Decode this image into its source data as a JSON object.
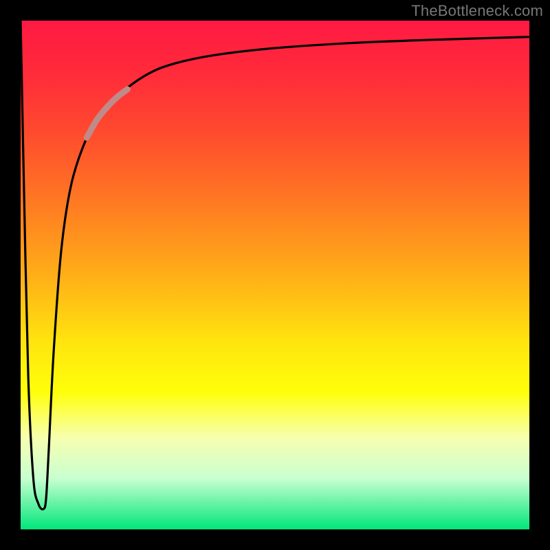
{
  "attribution": "TheBottleneck.com",
  "colors": {
    "background": "#000000",
    "gradient_top": "#ff1a44",
    "gradient_bottom": "#00e67a",
    "curve": "#000000",
    "highlight_segment": "#c08a88"
  },
  "chart_data": {
    "type": "line",
    "title": "",
    "xlabel": "",
    "ylabel": "",
    "xlim": [
      0,
      100
    ],
    "ylim": [
      0,
      100
    ],
    "axis_labels_visible": false,
    "gradient_stops": [
      {
        "pos": 0,
        "color": "#ff1a44"
      },
      {
        "pos": 36,
        "color": "#ff7a22"
      },
      {
        "pos": 63,
        "color": "#ffe40e"
      },
      {
        "pos": 82,
        "color": "#f7ffb0"
      },
      {
        "pos": 100,
        "color": "#00e67a"
      }
    ],
    "series": [
      {
        "name": "curve-main",
        "x": [
          0.0,
          0.7,
          1.5,
          2.5,
          3.5,
          4.5,
          5.0,
          5.5,
          6.5,
          8.0,
          10.0,
          13.0,
          16.0,
          20.0,
          25.0,
          30.0,
          38.0,
          50.0,
          65.0,
          80.0,
          100.0
        ],
        "y": [
          100.0,
          65.0,
          30.0,
          10.0,
          5.0,
          4.0,
          6.0,
          15.0,
          35.0,
          55.0,
          68.0,
          77.0,
          82.0,
          86.0,
          89.5,
          91.5,
          93.2,
          94.6,
          95.6,
          96.2,
          96.8
        ]
      },
      {
        "name": "highlight-segment",
        "x": [
          13.0,
          15.0,
          17.0,
          19.0,
          21.0
        ],
        "y": [
          77.0,
          80.5,
          83.0,
          85.0,
          86.5
        ]
      }
    ],
    "annotations": []
  }
}
